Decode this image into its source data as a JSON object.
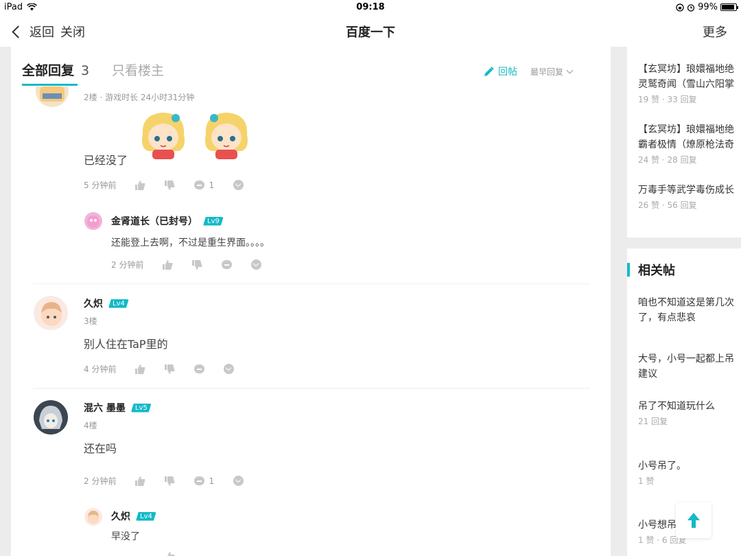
{
  "status": {
    "device": "iPad",
    "time": "09:18",
    "battery": "99%"
  },
  "nav": {
    "back": "返回",
    "close": "关闭",
    "title": "百度一下",
    "more": "更多"
  },
  "tabs": {
    "all_label": "全部回复",
    "all_count": "3",
    "host_only": "只看楼主",
    "reply": "回帖",
    "sort": "最早回复"
  },
  "posts": [
    {
      "meta": "2楼 · 游戏时长 24小时31分钟",
      "content": "已经没了",
      "time": "5 分钟前",
      "comment_count": "1",
      "reply": {
        "name": "金肾道长（已封号）",
        "level": "Lv9",
        "content": "还能登上去啊，不过是重生界面。。。。",
        "time": "2 分钟前"
      }
    },
    {
      "name": "久炽",
      "level": "Lv4",
      "floor": "3楼",
      "content": "别人住在TaP里的",
      "time": "4 分钟前"
    },
    {
      "name": "混六 墨墨",
      "level": "Lv5",
      "floor": "4楼",
      "content": "还在吗",
      "time": "2 分钟前",
      "comment_count": "1",
      "reply": {
        "name": "久炽",
        "level": "Lv4",
        "content": "早没了"
      }
    }
  ],
  "sidebar_top": [
    {
      "title_1": "【玄冥坊】琅嬛福地绝",
      "title_2": "灵鹫奇闻（雪山六阳掌",
      "stats": "19 赞 · 33 回复"
    },
    {
      "title_1": "【玄冥坊】琅嬛福地绝",
      "title_2": "霸者极情（燎原枪法奇",
      "stats": "24 赞 · 28 回复"
    },
    {
      "title_1": "万毒手等武学毒伤成长",
      "stats": "26 赞 · 56 回复"
    }
  ],
  "related": {
    "heading": "相关帖",
    "items": [
      {
        "title_1": "咱也不知道这是第几次",
        "title_2": "了，有点悲哀"
      },
      {
        "title_1": "大号，小号一起都上吊",
        "title_2": "建议"
      },
      {
        "title_1": "吊了不知道玩什么",
        "stats": "21 回复"
      },
      {
        "title_1": "小号吊了。",
        "stats": "1 赞"
      },
      {
        "title_1": "小号想吊",
        "stats": "1 赞 · 6 回复"
      }
    ]
  },
  "colors": {
    "accent": "#14b9c8",
    "background": "#ececec"
  }
}
